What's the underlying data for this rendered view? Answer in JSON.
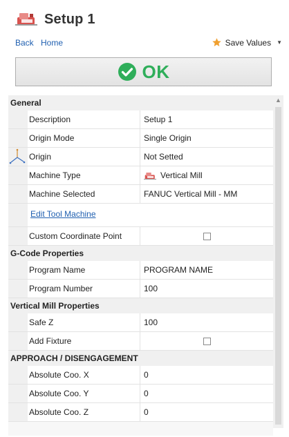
{
  "header": {
    "title": "Setup 1",
    "icon": "machine-icon"
  },
  "nav": {
    "back": "Back",
    "home": "Home",
    "save_values": "Save Values"
  },
  "ok_button": {
    "label": "OK"
  },
  "categories": {
    "general": "General",
    "gcode": "G-Code Properties",
    "vertical_mill": "Vertical Mill Properties",
    "approach": "APPROACH / DISENGAGEMENT"
  },
  "general": {
    "description": {
      "name": "Description",
      "value": "Setup 1"
    },
    "origin_mode": {
      "name": "Origin Mode",
      "value": "Single Origin"
    },
    "origin": {
      "name": "Origin",
      "value": "Not Setted"
    },
    "machine_type": {
      "name": "Machine Type",
      "value": "Vertical Mill"
    },
    "machine_selected": {
      "name": "Machine Selected",
      "value": "FANUC Vertical Mill - MM"
    },
    "edit_tool_machine": "Edit Tool Machine",
    "custom_coordinate_point": {
      "name": "Custom Coordinate Point",
      "checked": false
    }
  },
  "gcode": {
    "program_name": {
      "name": "Program Name",
      "value": "PROGRAM NAME"
    },
    "program_number": {
      "name": "Program Number",
      "value": "100"
    }
  },
  "vertical_mill": {
    "safe_z": {
      "name": "Safe Z",
      "value": "100"
    },
    "add_fixture": {
      "name": "Add Fixture",
      "checked": false
    }
  },
  "approach": {
    "abs_x": {
      "name": "Absolute Coo. X",
      "value": "0"
    },
    "abs_y": {
      "name": "Absolute Coo. Y",
      "value": "0"
    },
    "abs_z": {
      "name": "Absolute Coo. Z",
      "value": "0"
    }
  },
  "colors": {
    "accent_link": "#1f5fb0",
    "ok_green": "#2fae5a",
    "star": "#f0a030"
  }
}
